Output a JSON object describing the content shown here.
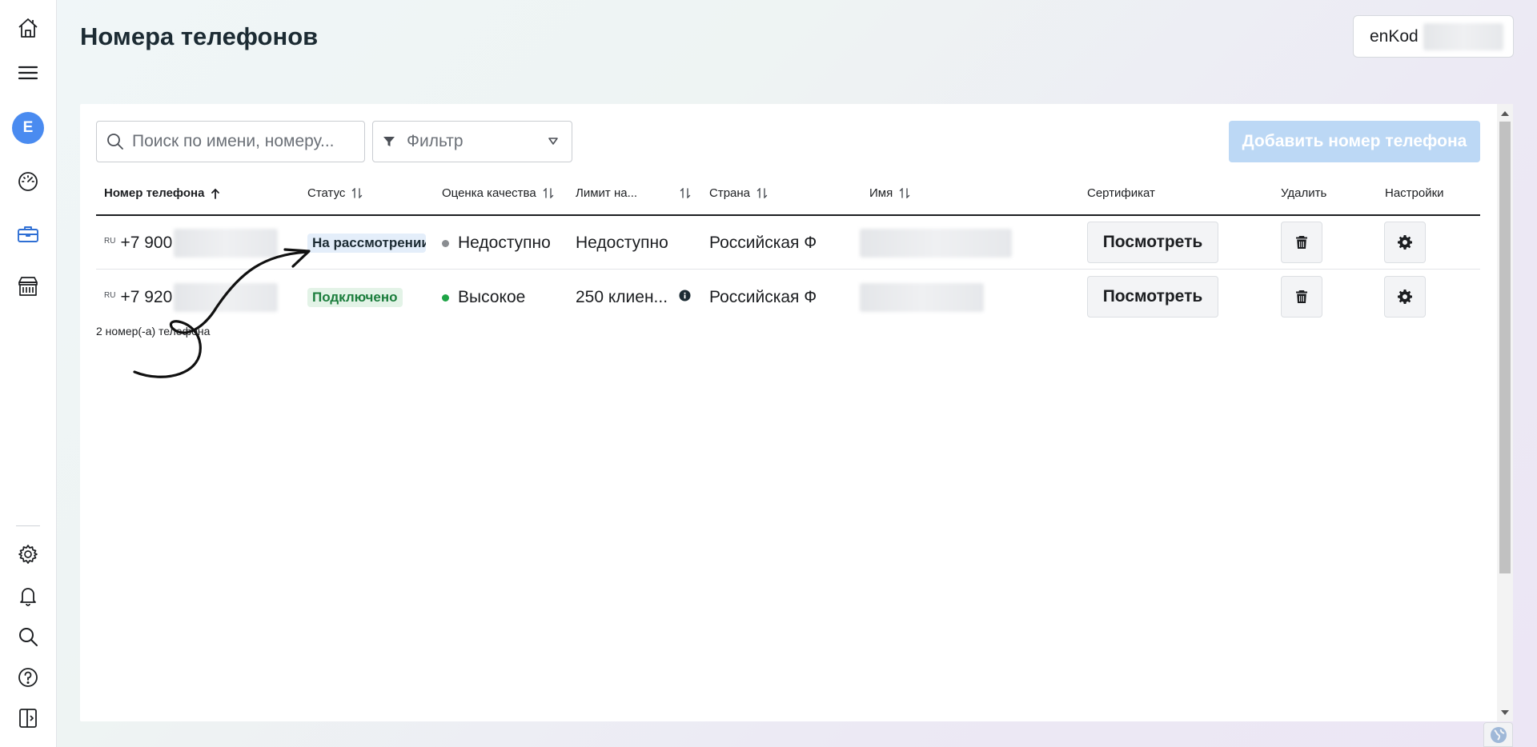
{
  "header": {
    "title": "Номера телефонов",
    "account_name": "enKod"
  },
  "sidebar": {
    "avatar_letter": "E",
    "items": [
      {
        "name": "home",
        "icon": "home-icon"
      },
      {
        "name": "menu",
        "icon": "hamburger-icon"
      },
      {
        "name": "account",
        "icon": "avatar"
      },
      {
        "name": "dashboard",
        "icon": "gauge-icon"
      },
      {
        "name": "business-tools",
        "icon": "briefcase-icon"
      },
      {
        "name": "store",
        "icon": "storefront-icon"
      },
      {
        "name": "settings",
        "icon": "gear-icon"
      },
      {
        "name": "notifications",
        "icon": "bell-icon"
      },
      {
        "name": "search",
        "icon": "search-icon"
      },
      {
        "name": "help",
        "icon": "help-icon"
      },
      {
        "name": "toggle-panel",
        "icon": "panel-toggle-icon"
      }
    ]
  },
  "toolbar": {
    "search_placeholder": "Поиск по имени, номеру...",
    "filter_label": "Фильтр",
    "add_button": "Добавить номер телефона"
  },
  "table": {
    "columns": {
      "phone": "Номер телефона",
      "status": "Статус",
      "quality": "Оценка качества",
      "limit": "Лимит на...",
      "country": "Страна",
      "name": "Имя",
      "certificate": "Сертификат",
      "delete": "Удалить",
      "settings": "Настройки"
    },
    "rows": [
      {
        "country_code": "RU",
        "phone": "+7 900",
        "status": "На рассмотрении",
        "quality": "Недоступно",
        "quality_color": "#8a8d91",
        "limit": "Недоступно",
        "country": "Российская Ф",
        "certificate_button": "Посмотреть"
      },
      {
        "country_code": "RU",
        "phone": "+7 920",
        "status": "Подключено",
        "quality": "Высокое",
        "quality_color": "#1ea446",
        "limit": "250 клиен...",
        "country": "Российская Ф",
        "certificate_button": "Посмотреть"
      }
    ],
    "count_text": "2 номер(-а) телефона"
  },
  "colors": {
    "accent": "#4a8bf0",
    "add_button_disabled": "#bcd8f5",
    "status_ok": "#1b7d3c"
  }
}
